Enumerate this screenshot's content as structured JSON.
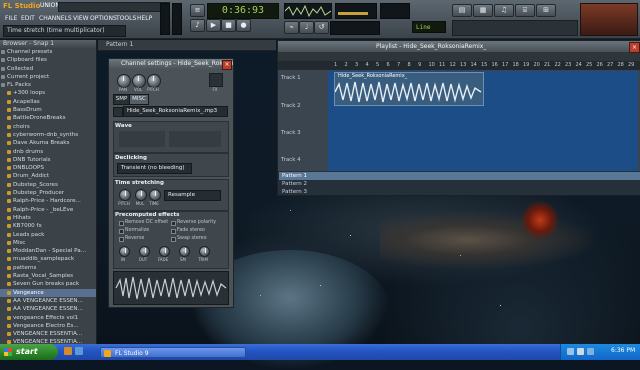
{
  "app": {
    "logo": "FL Studio",
    "song_name": "UNION",
    "menu": [
      "FILE",
      "EDIT",
      "CHANNELS",
      "VIEW",
      "OPTIONS",
      "TOOLS",
      "HELP"
    ],
    "hint": "Time stretch (time multiplicator)",
    "time_display": "0:36:93",
    "pattern_label": "Pattern 1",
    "line_label": "Line"
  },
  "browser": {
    "title": "Browser - Snap 1",
    "items": [
      {
        "label": "Channel presets",
        "type": "folder"
      },
      {
        "label": "Clipboard files",
        "type": "folder"
      },
      {
        "label": "Collected",
        "type": "folder"
      },
      {
        "label": "Current project",
        "type": "folder"
      },
      {
        "label": "FL Packs",
        "type": "folder"
      },
      {
        "label": "+300 loops",
        "type": "sub"
      },
      {
        "label": "Acapellas",
        "type": "sub"
      },
      {
        "label": "BassDrum",
        "type": "sub"
      },
      {
        "label": "BattleDroneBreaks",
        "type": "sub"
      },
      {
        "label": "choirs",
        "type": "sub"
      },
      {
        "label": "cyberworm-dnb_synths",
        "type": "sub"
      },
      {
        "label": "Dave Akuma Breaks",
        "type": "sub"
      },
      {
        "label": "dnb drums",
        "type": "sub"
      },
      {
        "label": "DNB Tutorials",
        "type": "sub"
      },
      {
        "label": "DNBLOOPS",
        "type": "sub"
      },
      {
        "label": "Drum_Addict",
        "type": "sub"
      },
      {
        "label": "Dubstep_Scores",
        "type": "sub"
      },
      {
        "label": "Dubstep_Producer",
        "type": "sub"
      },
      {
        "label": "Ralph-Price - Hardcore...",
        "type": "sub"
      },
      {
        "label": "Ralph-Price - _beLEve",
        "type": "sub"
      },
      {
        "label": "Hihats",
        "type": "sub"
      },
      {
        "label": "KB7000 fx",
        "type": "sub"
      },
      {
        "label": "Leads pack",
        "type": "sub"
      },
      {
        "label": "Misc",
        "type": "sub"
      },
      {
        "label": "ModdanDan - Special Pa...",
        "type": "sub"
      },
      {
        "label": "muaddib_samplepack",
        "type": "sub"
      },
      {
        "label": "patterns",
        "type": "sub"
      },
      {
        "label": "Rasta_Vocal_Samples",
        "type": "sub"
      },
      {
        "label": "Seven Gun breaks pack",
        "type": "sub"
      },
      {
        "label": "Vengeance",
        "type": "sub",
        "selected": true
      },
      {
        "label": "AA VENGEANCE ESSEN...",
        "type": "sub"
      },
      {
        "label": "AA VENGEANCE ESSEN...",
        "type": "sub"
      },
      {
        "label": "vengeance Effects vol1",
        "type": "sub"
      },
      {
        "label": "Vengeance Electro Es...",
        "type": "sub"
      },
      {
        "label": "VENGEANCE ESSENTIA...",
        "type": "sub"
      },
      {
        "label": "VENGEANCE ESSENTIA...",
        "type": "sub"
      }
    ]
  },
  "channel_settings": {
    "title": "Channel settings - Hide_Seek_Roksoni...",
    "tabs": [
      "SMP",
      "MISC"
    ],
    "sample_file": "Hide_Seek_RoksoniaRemix_.mp3",
    "knob_labels": [
      "PAN",
      "VOL",
      "PITCH",
      "FX"
    ],
    "wave_label": "Wave",
    "declicking_label": "Declicking",
    "declick_mode": "Transient (no bleeding)",
    "time_stretching_label": "Time stretching",
    "stretch_knobs": [
      "PITCH",
      "MUL",
      "TIME"
    ],
    "stretch_mode": "Resample",
    "precomputed_label": "Precomputed effects",
    "effects": [
      "Remove DC offset",
      "Reverse polarity",
      "Normalize",
      "Fade stereo",
      "Reverse",
      "Swap stereo"
    ],
    "fx_knobs": [
      "IN",
      "OUT",
      "FADE",
      "SM",
      "TRIM"
    ]
  },
  "playlist": {
    "title": "Playlist - Hide_Seek_RoksoniaRemix_",
    "tracks": [
      "Track 1",
      "Track 2",
      "Track 3",
      "Track 4"
    ],
    "clip_name": "Hide_Seek_RoksoniaRemix_",
    "bar_numbers": [
      "1",
      "2",
      "3",
      "4",
      "5",
      "6",
      "7",
      "8",
      "9",
      "10",
      "11",
      "12",
      "13",
      "14",
      "15",
      "16",
      "17",
      "18",
      "19",
      "20",
      "21",
      "22",
      "23",
      "24",
      "25",
      "26",
      "27",
      "28",
      "29"
    ],
    "patterns": [
      "Pattern 1",
      "Pattern 2",
      "Pattern 3"
    ]
  },
  "taskbar": {
    "start_label": "start",
    "task_label": "FL Studio 9",
    "clock": "6:36 PM"
  }
}
